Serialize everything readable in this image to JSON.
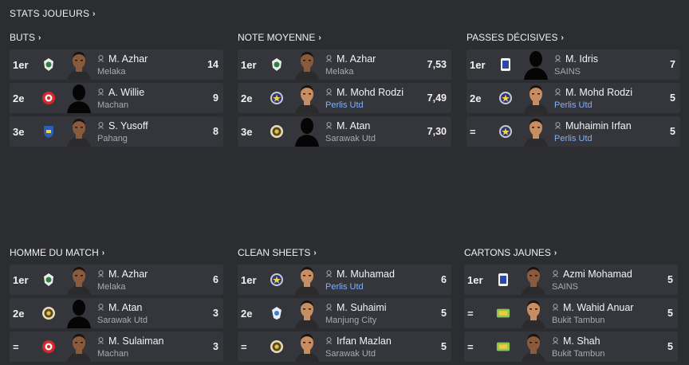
{
  "header": {
    "title": "STATS JOUEURS"
  },
  "panels": [
    {
      "title": "BUTS",
      "rows": [
        {
          "rank": "1er",
          "name": "M. Azhar",
          "club": "Melaka",
          "value": "14",
          "club_link": false,
          "badge": "melaka-badge-icon",
          "face": "dark"
        },
        {
          "rank": "2e",
          "name": "A. Willie",
          "club": "Machan",
          "value": "9",
          "club_link": false,
          "badge": "machan-badge-icon",
          "face": "silhouette"
        },
        {
          "rank": "3e",
          "name": "S. Yusoff",
          "club": "Pahang",
          "value": "8",
          "club_link": false,
          "badge": "pahang-badge-icon",
          "face": "dark"
        }
      ]
    },
    {
      "title": "NOTE MOYENNE",
      "rows": [
        {
          "rank": "1er",
          "name": "M. Azhar",
          "club": "Melaka",
          "value": "7,53",
          "club_link": false,
          "badge": "melaka-badge-icon",
          "face": "dark"
        },
        {
          "rank": "2e",
          "name": "M. Mohd Rodzi",
          "club": "Perlis Utd",
          "value": "7,49",
          "club_link": true,
          "badge": "perlis-badge-icon",
          "face": "light"
        },
        {
          "rank": "3e",
          "name": "M. Atan",
          "club": "Sarawak Utd",
          "value": "7,30",
          "club_link": false,
          "badge": "sarawak-badge-icon",
          "face": "silhouette"
        }
      ]
    },
    {
      "title": "PASSES DÉCISIVES",
      "rows": [
        {
          "rank": "1er",
          "name": "M. Idris",
          "club": "SAINS",
          "value": "7",
          "club_link": false,
          "badge": "sains-badge-icon",
          "face": "silhouette"
        },
        {
          "rank": "2e",
          "name": "M. Mohd Rodzi",
          "club": "Perlis Utd",
          "value": "5",
          "club_link": true,
          "badge": "perlis-badge-icon",
          "face": "light"
        },
        {
          "rank": "=",
          "name": "Muhaimin Irfan",
          "club": "Perlis Utd",
          "value": "5",
          "club_link": true,
          "badge": "perlis-badge-icon",
          "face": "light"
        }
      ]
    },
    {
      "title": "HOMME DU MATCH",
      "rows": [
        {
          "rank": "1er",
          "name": "M. Azhar",
          "club": "Melaka",
          "value": "6",
          "club_link": false,
          "badge": "melaka-badge-icon",
          "face": "dark"
        },
        {
          "rank": "2e",
          "name": "M. Atan",
          "club": "Sarawak Utd",
          "value": "3",
          "club_link": false,
          "badge": "sarawak-badge-icon",
          "face": "silhouette"
        },
        {
          "rank": "=",
          "name": "M. Sulaiman",
          "club": "Machan",
          "value": "3",
          "club_link": false,
          "badge": "machan-badge-icon",
          "face": "dark"
        }
      ]
    },
    {
      "title": "CLEAN SHEETS",
      "rows": [
        {
          "rank": "1er",
          "name": "M. Muhamad",
          "club": "Perlis Utd",
          "value": "6",
          "club_link": true,
          "badge": "perlis-badge-icon",
          "face": "light"
        },
        {
          "rank": "2e",
          "name": "M. Suhaimi",
          "club": "Manjung City",
          "value": "5",
          "club_link": false,
          "badge": "manjung-badge-icon",
          "face": "light"
        },
        {
          "rank": "=",
          "name": "Irfan Mazlan",
          "club": "Sarawak Utd",
          "value": "5",
          "club_link": false,
          "badge": "sarawak-badge-icon",
          "face": "light"
        }
      ]
    },
    {
      "title": "CARTONS JAUNES",
      "rows": [
        {
          "rank": "1er",
          "name": "Azmi Mohamad",
          "club": "SAINS",
          "value": "5",
          "club_link": false,
          "badge": "sains-badge-icon",
          "face": "dark"
        },
        {
          "rank": "=",
          "name": "M. Wahid Anuar",
          "club": "Bukit Tambun",
          "value": "5",
          "club_link": false,
          "badge": "bukit-tambun-badge-icon",
          "face": "light"
        },
        {
          "rank": "=",
          "name": "M. Shah",
          "club": "Bukit Tambun",
          "value": "5",
          "club_link": false,
          "badge": "bukit-tambun-badge-icon",
          "face": "dark"
        }
      ]
    }
  ],
  "colors": {
    "background": "#2b2d31",
    "row": "#34363c",
    "link": "#7fb0ff"
  }
}
